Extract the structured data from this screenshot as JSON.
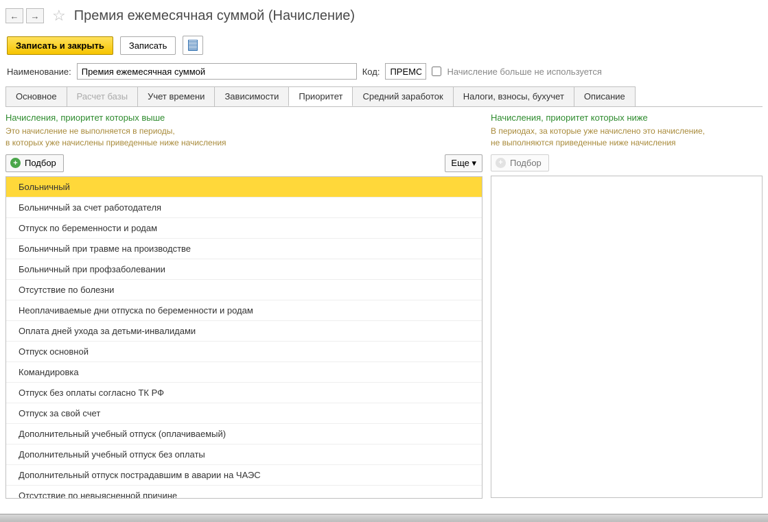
{
  "header": {
    "title": "Премия ежемесячная суммой (Начисление)"
  },
  "toolbar": {
    "save_close": "Записать и закрыть",
    "save": "Записать"
  },
  "form": {
    "name_label": "Наименование:",
    "name_value": "Премия ежемесячная суммой",
    "code_label": "Код:",
    "code_value": "ПРЕМС",
    "unused_label": "Начисление больше не используется"
  },
  "tabs": [
    {
      "label": "Основное",
      "active": false,
      "disabled": false
    },
    {
      "label": "Расчет базы",
      "active": false,
      "disabled": true
    },
    {
      "label": "Учет времени",
      "active": false,
      "disabled": false
    },
    {
      "label": "Зависимости",
      "active": false,
      "disabled": false
    },
    {
      "label": "Приоритет",
      "active": true,
      "disabled": false
    },
    {
      "label": "Средний заработок",
      "active": false,
      "disabled": false
    },
    {
      "label": "Налоги, взносы, бухучет",
      "active": false,
      "disabled": false
    },
    {
      "label": "Описание",
      "active": false,
      "disabled": false
    }
  ],
  "left": {
    "title": "Начисления, приоритет которых выше",
    "desc1": "Это начисление не выполняется в периоды,",
    "desc2": "в которых уже начислены приведенные ниже начисления",
    "podbor": "Подбор",
    "more": "Еще ▾",
    "items": [
      "Больничный",
      "Больничный за счет работодателя",
      "Отпуск по беременности и родам",
      "Больничный при травме на производстве",
      "Больничный при профзаболевании",
      "Отсутствие по болезни",
      "Неоплачиваемые дни отпуска по беременности и родам",
      "Оплата дней ухода за детьми-инвалидами",
      "Отпуск основной",
      "Командировка",
      "Отпуск без оплаты согласно ТК РФ",
      "Отпуск за свой счет",
      "Дополнительный учебный отпуск (оплачиваемый)",
      "Дополнительный учебный отпуск без оплаты",
      "Дополнительный отпуск пострадавшим в аварии на ЧАЭС",
      "Отсутствие по невыясненной причине"
    ]
  },
  "right": {
    "title": "Начисления, приоритет которых ниже",
    "desc1": "В периодах, за которые уже начислено это начисление,",
    "desc2": "не выполняются приведенные ниже начисления",
    "podbor": "Подбор"
  }
}
